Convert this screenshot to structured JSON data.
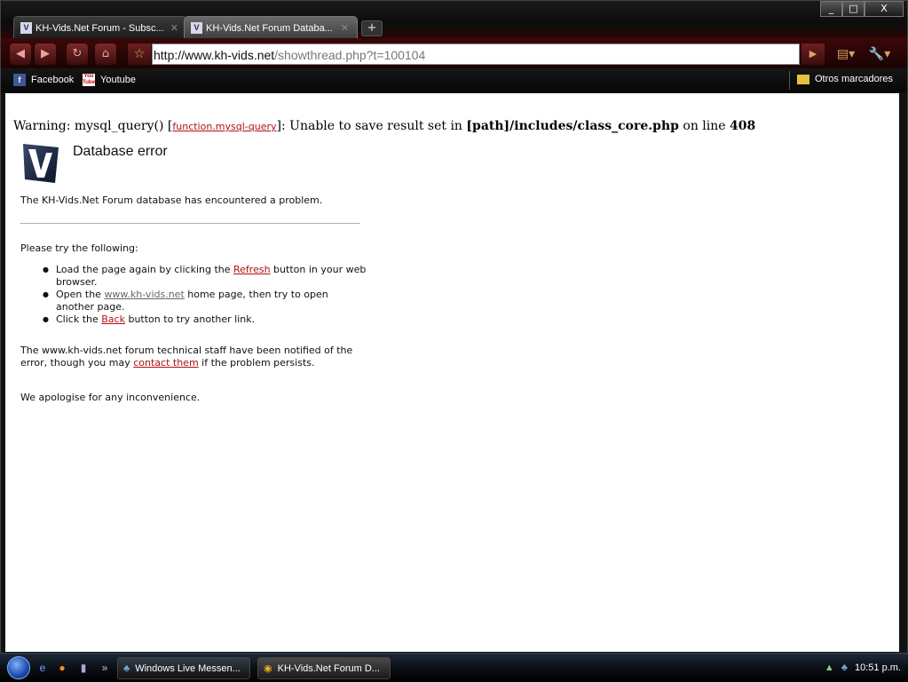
{
  "browser": {
    "tabs": [
      {
        "title": "KH-Vids.Net Forum - Subsc..."
      },
      {
        "title": "KH-Vids.Net Forum Databa..."
      }
    ],
    "new_tab": "+",
    "window_buttons": {
      "minimize": "_",
      "maximize": "□",
      "close": "X"
    },
    "url_domain": "http://www.kh-vids.net",
    "url_path": "/showthread.php?t=100104",
    "bookmarks": [
      {
        "label": "Facebook",
        "icon": "facebook-icon"
      },
      {
        "label": "Youtube",
        "icon": "youtube-icon"
      }
    ],
    "other_bookmarks": "Otros marcadores"
  },
  "page": {
    "warning_prefix": "Warning",
    "warning_func": ": mysql_query() [",
    "warning_link": "function.mysql-query",
    "warning_mid": "]: Unable to save result set in ",
    "warning_path": "[path]/includes/class_core.php",
    "warning_online": " on line ",
    "warning_line": "408",
    "heading": "Database error",
    "intro": "The KH-Vids.Net Forum database has encountered a problem.",
    "try_heading": "Please try the following:",
    "item1_a": "Load the page again by clicking the ",
    "item1_link": "Refresh",
    "item1_b": " button in your web browser.",
    "item2_a": "Open the ",
    "item2_link": "www.kh-vids.net",
    "item2_b": " home page, then try to open another page.",
    "item3_a": "Click the ",
    "item3_link": "Back",
    "item3_b": " button to try another link.",
    "notice_a": "The www.kh-vids.net forum technical staff have been notified of the error, though you may ",
    "notice_link": "contact them",
    "notice_b": " if the problem persists.",
    "apology": "We apologise for any inconvenience."
  },
  "taskbar": {
    "items": [
      {
        "label": "Windows Live Messen..."
      },
      {
        "label": "KH-Vids.Net Forum D..."
      }
    ],
    "overflow": "»",
    "clock": "10:51 p.m."
  }
}
